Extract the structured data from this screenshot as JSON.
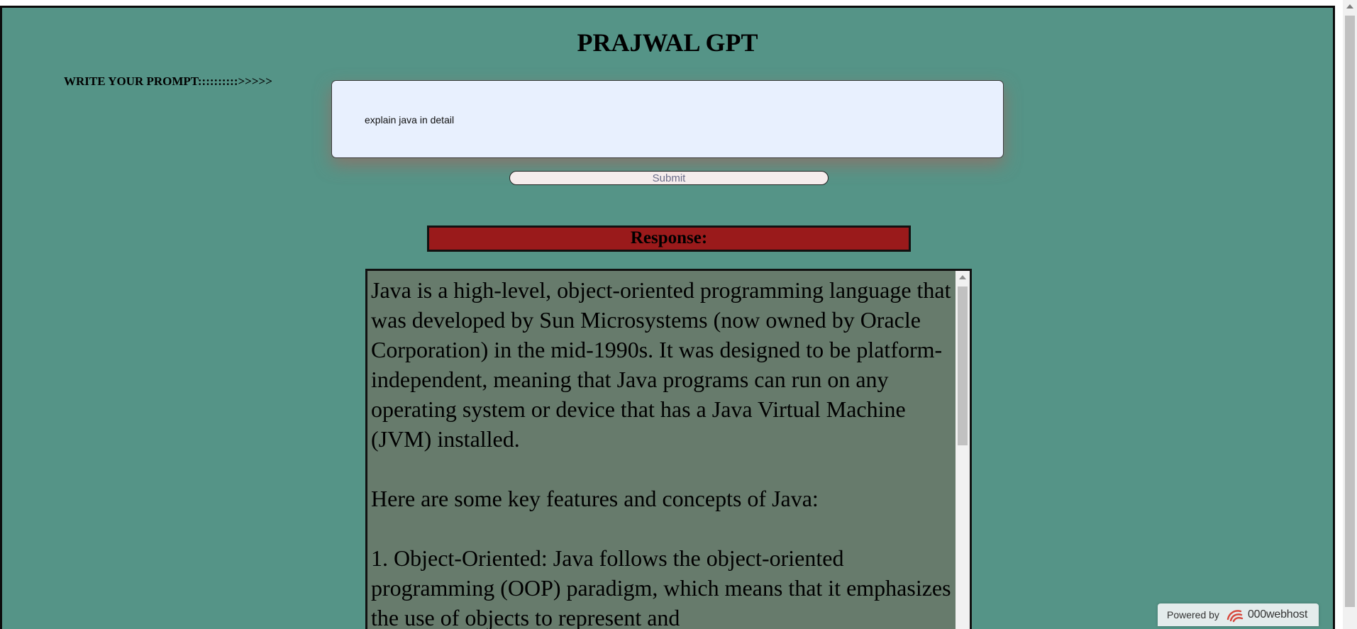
{
  "header": {
    "title": "PRAJWAL GPT"
  },
  "prompt": {
    "label": "WRITE YOUR PROMPT::::::::::>>>>>",
    "value": "explain java in detail"
  },
  "submit_label": "Submit",
  "response": {
    "heading": "Response:",
    "text": "Java is a high-level, object-oriented programming language that was developed by Sun Microsystems (now owned by Oracle Corporation) in the mid-1990s. It was designed to be platform-independent, meaning that Java programs can run on any operating system or device that has a Java Virtual Machine (JVM) installed.\n\nHere are some key features and concepts of Java:\n\n1. Object-Oriented: Java follows the object-oriented programming (OOP) paradigm, which means that it emphasizes the use of objects to represent and"
  },
  "footer": {
    "powered_by": "Powered by",
    "brand": "000webhost",
    "logo_icon": "000webhost-logo-icon"
  },
  "colors": {
    "page_background": "#559487",
    "response_heading_background": "#9a1a1b",
    "response_box_background": "#677b6c",
    "prompt_box_background": "#e8f0fe",
    "brand_accent": "#d8453a"
  }
}
